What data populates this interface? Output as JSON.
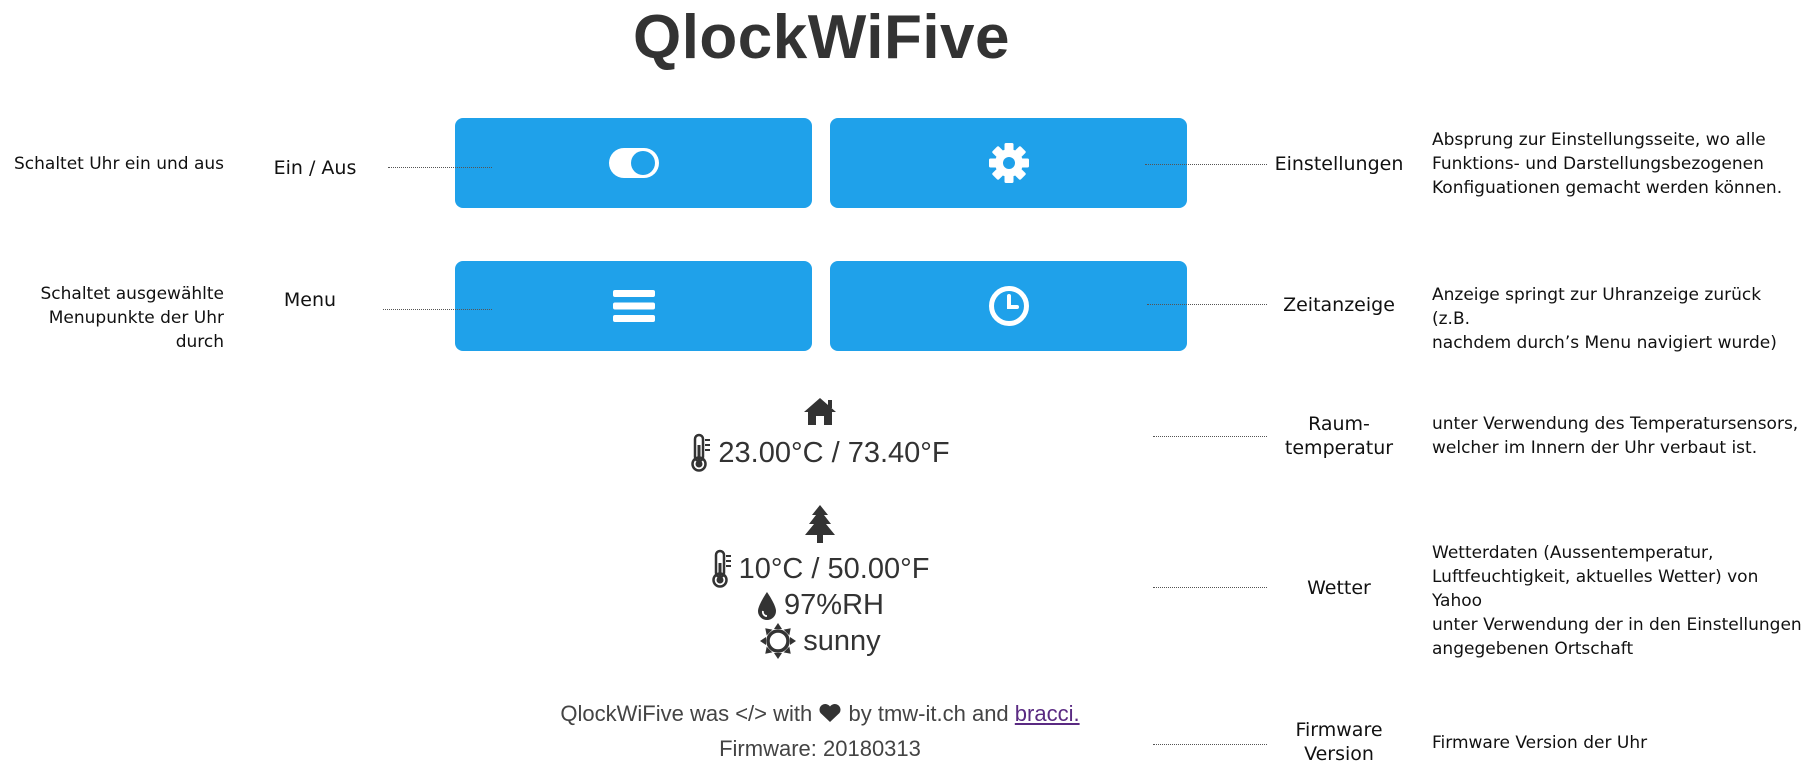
{
  "app": {
    "title": "QlockWiFive"
  },
  "buttons": {
    "power": {
      "label": "Ein / Aus",
      "icon": "toggle-on-icon",
      "description": "Schaltet Uhr ein und aus"
    },
    "menu": {
      "label": "Menu",
      "icon": "menu-bars-icon",
      "description_line1": "Schaltet ausgewählte",
      "description_line2": "Menupunkte der Uhr durch"
    },
    "settings": {
      "label": "Einstellungen",
      "icon": "gear-icon",
      "description_line1": "Absprung zur Einstellungsseite, wo alle",
      "description_line2": "Funktions- und Darstellungsbezogenen",
      "description_line3": "Konfiguationen gemacht werden können."
    },
    "clock": {
      "label": "Zeitanzeige",
      "icon": "clock-icon",
      "description_line1": "Anzeige springt zur Uhranzeige zurück (z.B.",
      "description_line2": "nachdem durch’s Menu navigiert wurde)"
    }
  },
  "room": {
    "label_line1": "Raum-",
    "label_line2": "temperatur",
    "temperature": "23.00°C / 73.40°F",
    "description_line1": "unter Verwendung des Temperatursensors,",
    "description_line2": "welcher im Innern der Uhr verbaut ist."
  },
  "weather": {
    "label": "Wetter",
    "temperature": "10°C / 50.00°F",
    "humidity": "97%RH",
    "condition": "sunny",
    "description_line1": "Wetterdaten (Aussentemperatur,",
    "description_line2": "Luftfeuchtigkeit, aktuelles Wetter) von Yahoo",
    "description_line3": "unter Verwendung der in den Einstellungen",
    "description_line4": "angegebenen Ortschaft"
  },
  "footer": {
    "credit_prefix": "QlockWiFive was </> with",
    "credit_middle": "by tmw-it.ch and",
    "credit_link": "bracci.",
    "firmware": "Firmware: 20180313",
    "label_line1": "Firmware",
    "label_line2": "Version",
    "description": "Firmware Version der Uhr"
  },
  "colors": {
    "button_blue": "#1fa1ea",
    "icon_dark": "#333333",
    "link_purple": "#5a2a82"
  }
}
